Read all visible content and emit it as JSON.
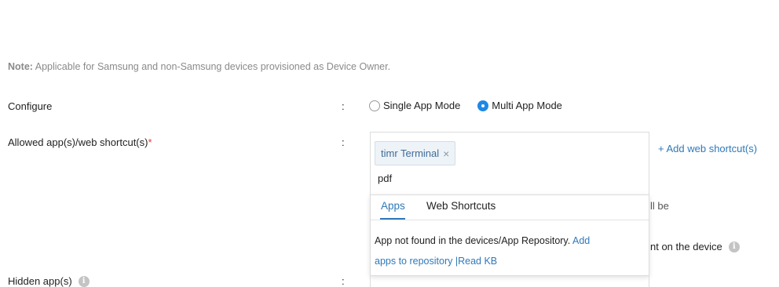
{
  "note": {
    "prefix": "Note:",
    "text": " Applicable for Samsung and non-Samsung devices provisioned as Device Owner."
  },
  "configure": {
    "label": "Configure",
    "colon": ":",
    "options": [
      {
        "label": "Single App Mode",
        "checked": false
      },
      {
        "label": "Multi App Mode",
        "checked": true
      }
    ]
  },
  "allowed_apps": {
    "label": "Allowed app(s)/web shortcut(s)",
    "required_mark": "*",
    "colon": ":",
    "chip_label": "timr Terminal",
    "chip_remove": "×",
    "search_value": "pdf",
    "add_web_shortcut": "+ Add web shortcut(s)"
  },
  "dropdown": {
    "tabs": [
      "Apps",
      "Web Shortcuts"
    ],
    "message_text": "App not found in the devices/App Repository. ",
    "add_link": "Add apps to repository",
    "separator": " |",
    "read_kb_link": "Read KB"
  },
  "behind_text": {
    "line1": "ll be",
    "line2": "nt on the device"
  },
  "hidden_apps": {
    "label": "Hidden app(s)",
    "colon": ":"
  },
  "info_glyph": "i",
  "accent_color": "#1e88e5",
  "link_color": "#2f79b9"
}
